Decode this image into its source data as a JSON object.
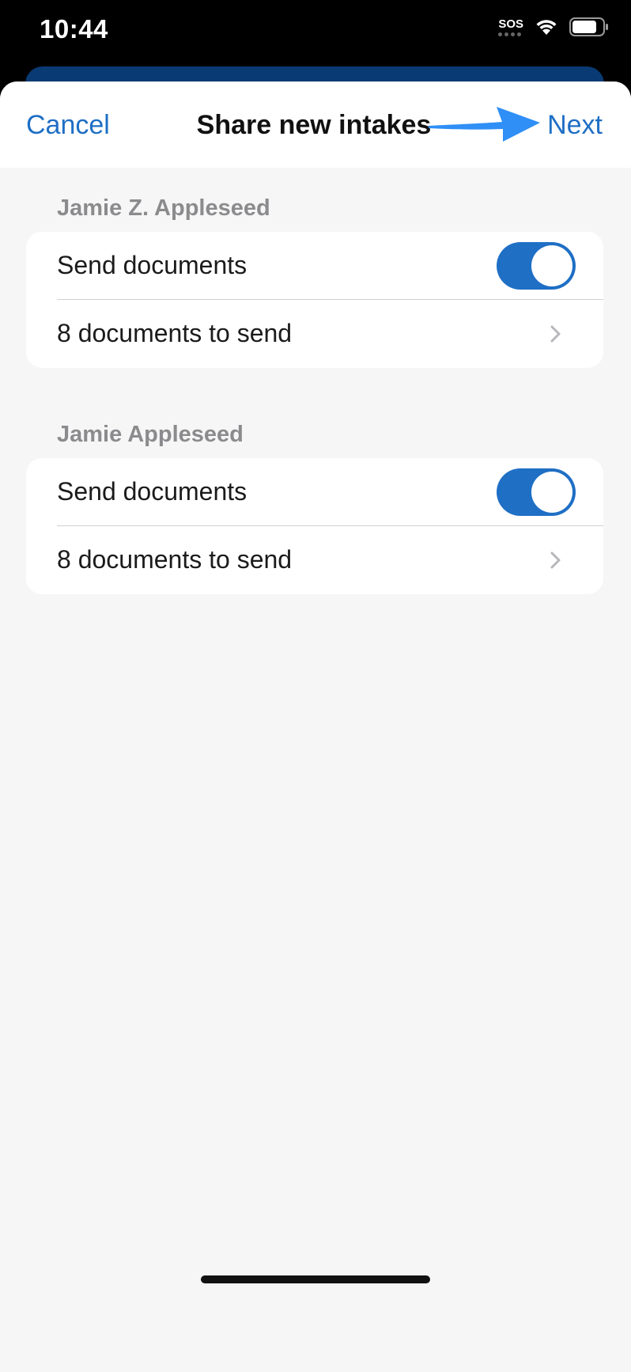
{
  "status_bar": {
    "time": "10:44",
    "sos": "SOS",
    "icons": [
      "wifi-icon",
      "battery-icon"
    ]
  },
  "nav": {
    "cancel_label": "Cancel",
    "title": "Share new intakes",
    "next_label": "Next"
  },
  "sections": [
    {
      "header": "Jamie Z. Appleseed",
      "toggle_label": "Send documents",
      "toggle_on": true,
      "documents_label": "8 documents to send"
    },
    {
      "header": "Jamie Appleseed",
      "toggle_label": "Send documents",
      "toggle_on": true,
      "documents_label": "8 documents to send"
    }
  ],
  "colors": {
    "accent": "#1f6fc5",
    "annotation_arrow": "#2f8ff6",
    "background": "#f6f6f6"
  }
}
